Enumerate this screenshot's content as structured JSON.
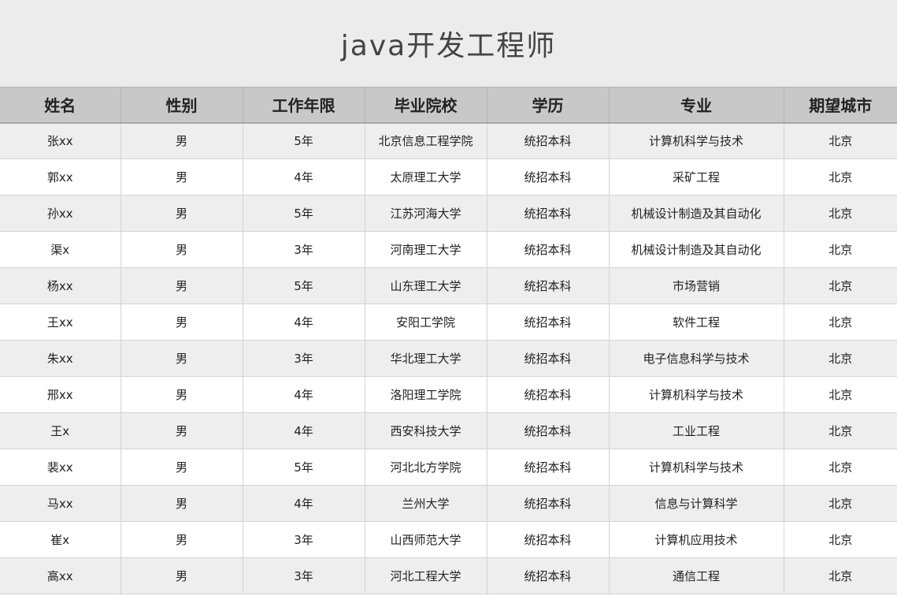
{
  "title": "java开发工程师",
  "table": {
    "headers": [
      "姓名",
      "性别",
      "工作年限",
      "毕业院校",
      "学历",
      "专业",
      "期望城市"
    ],
    "rows": [
      [
        "张xx",
        "男",
        "5年",
        "北京信息工程学院",
        "统招本科",
        "计算机科学与技术",
        "北京"
      ],
      [
        "郭xx",
        "男",
        "4年",
        "太原理工大学",
        "统招本科",
        "采矿工程",
        "北京"
      ],
      [
        "孙xx",
        "男",
        "5年",
        "江苏河海大学",
        "统招本科",
        "机械设计制造及其自动化",
        "北京"
      ],
      [
        "渠x",
        "男",
        "3年",
        "河南理工大学",
        "统招本科",
        "机械设计制造及其自动化",
        "北京"
      ],
      [
        "杨xx",
        "男",
        "5年",
        "山东理工大学",
        "统招本科",
        "市场营销",
        "北京"
      ],
      [
        "王xx",
        "男",
        "4年",
        "安阳工学院",
        "统招本科",
        "软件工程",
        "北京"
      ],
      [
        "朱xx",
        "男",
        "3年",
        "华北理工大学",
        "统招本科",
        "电子信息科学与技术",
        "北京"
      ],
      [
        "邢xx",
        "男",
        "4年",
        "洛阳理工学院",
        "统招本科",
        "计算机科学与技术",
        "北京"
      ],
      [
        "王x",
        "男",
        "4年",
        "西安科技大学",
        "统招本科",
        "工业工程",
        "北京"
      ],
      [
        "裴xx",
        "男",
        "5年",
        "河北北方学院",
        "统招本科",
        "计算机科学与技术",
        "北京"
      ],
      [
        "马xx",
        "男",
        "4年",
        "兰州大学",
        "统招本科",
        "信息与计算科学",
        "北京"
      ],
      [
        "崔x",
        "男",
        "3年",
        "山西师范大学",
        "统招本科",
        "计算机应用技术",
        "北京"
      ],
      [
        "高xx",
        "男",
        "3年",
        "河北工程大学",
        "统招本科",
        "通信工程",
        "北京"
      ]
    ]
  }
}
